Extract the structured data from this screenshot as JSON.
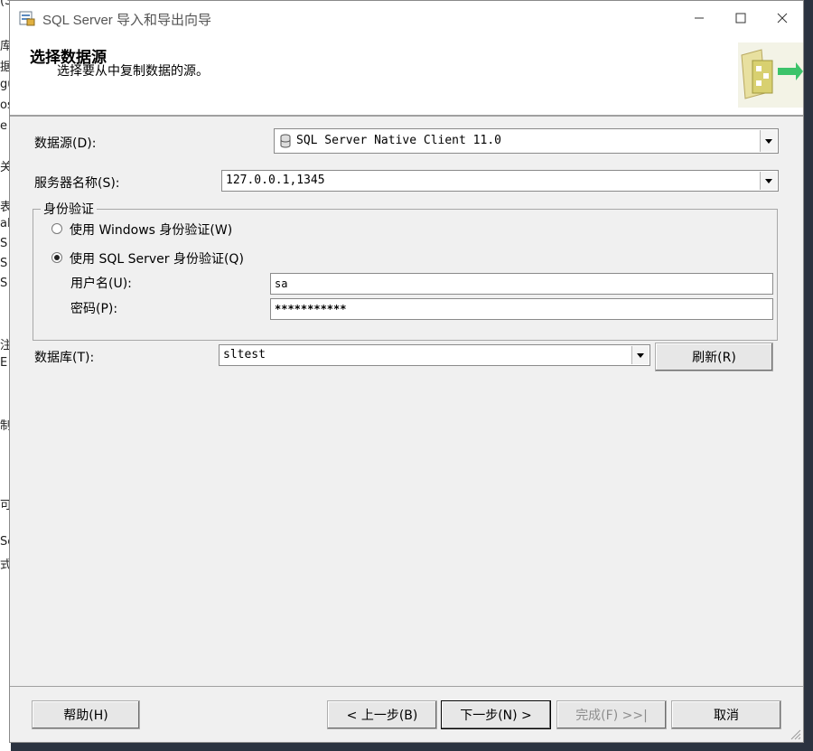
{
  "window": {
    "title": "SQL Server 导入和导出向导",
    "minimize_icon": "minimize-icon",
    "maximize_icon": "maximize-icon",
    "close_icon": "close-icon"
  },
  "background_text": [
    "(S",
    "库",
    "据",
    "gu",
    "os",
    "e",
    "关",
    "表",
    "al",
    "S",
    "S",
    "S",
    "注",
    "E",
    "制",
    "可",
    "Se",
    "式"
  ],
  "header": {
    "title": "选择数据源",
    "subtitle": "选择要从中复制数据的源。"
  },
  "form": {
    "datasource_label": "数据源(D):",
    "datasource_value": "SQL Server Native Client 11.0",
    "server_label": "服务器名称(S):",
    "server_value": "127.0.0.1,1345",
    "auth_group_title": "身份验证",
    "auth_windows_label": "使用 Windows 身份验证(W)",
    "auth_sql_label": "使用 SQL Server 身份验证(Q)",
    "auth_selected": "sql",
    "username_label": "用户名(U):",
    "username_value": "sa",
    "password_label": "密码(P):",
    "password_value": "***********",
    "database_label": "数据库(T):",
    "database_value": "sltest",
    "refresh_button": "刷新(R)"
  },
  "footer": {
    "help_button": "帮助(H)",
    "back_button": "< 上一步(B)",
    "next_button": "下一步(N) >",
    "finish_button": "完成(F) >>|",
    "cancel_button": "取消"
  }
}
